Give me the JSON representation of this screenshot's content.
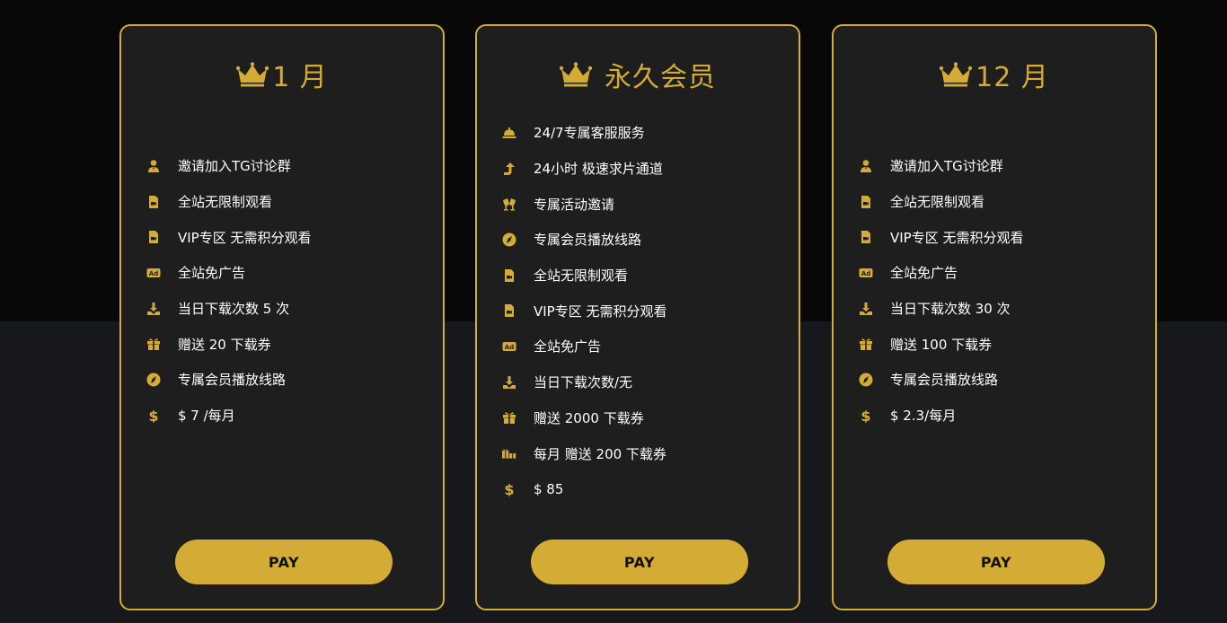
{
  "accent_color": "#d4ac35",
  "plans": [
    {
      "title": "1 月",
      "features": [
        {
          "icon": "user-icon",
          "text": "邀请加入TG讨论群"
        },
        {
          "icon": "video-file-icon",
          "text": "全站无限制观看"
        },
        {
          "icon": "video-file-icon",
          "text": "VIP专区 无需积分观看"
        },
        {
          "icon": "ad-icon",
          "text": "全站免广告"
        },
        {
          "icon": "download-icon",
          "text": "当日下载次数 5 次"
        },
        {
          "icon": "gift-icon",
          "text": "赠送 20 下载券"
        },
        {
          "icon": "compass-icon",
          "text": "专属会员播放线路"
        },
        {
          "icon": "dollar-icon",
          "text": "$ 7 /每月"
        }
      ],
      "pay_label": "PAY"
    },
    {
      "title": "永久会员",
      "features": [
        {
          "icon": "concierge-bell-icon",
          "text": "24/7专属客服服务"
        },
        {
          "icon": "turn-up-arrow-icon",
          "text": "24小时 极速求片通道"
        },
        {
          "icon": "cheers-icon",
          "text": "专属活动邀请"
        },
        {
          "icon": "compass-icon",
          "text": "专属会员播放线路"
        },
        {
          "icon": "video-file-icon",
          "text": "全站无限制观看"
        },
        {
          "icon": "video-file-icon",
          "text": "VIP专区 无需积分观看"
        },
        {
          "icon": "ad-icon",
          "text": "全站免广告"
        },
        {
          "icon": "download-icon",
          "text": "当日下载次数/无"
        },
        {
          "icon": "gift-icon",
          "text": "赠送 2000 下载券"
        },
        {
          "icon": "gifts-icon",
          "text": "每月 赠送 200 下载券"
        },
        {
          "icon": "dollar-icon",
          "text": "$ 85"
        }
      ],
      "pay_label": "PAY"
    },
    {
      "title": "12 月",
      "features": [
        {
          "icon": "user-icon",
          "text": "邀请加入TG讨论群"
        },
        {
          "icon": "video-file-icon",
          "text": "全站无限制观看"
        },
        {
          "icon": "video-file-icon",
          "text": "VIP专区 无需积分观看"
        },
        {
          "icon": "ad-icon",
          "text": "全站免广告"
        },
        {
          "icon": "download-icon",
          "text": "当日下载次数 30 次"
        },
        {
          "icon": "gift-icon",
          "text": "赠送 100 下载券"
        },
        {
          "icon": "compass-icon",
          "text": "专属会员播放线路"
        },
        {
          "icon": "dollar-icon",
          "text": "$ 2.3/每月"
        }
      ],
      "pay_label": "PAY"
    }
  ]
}
